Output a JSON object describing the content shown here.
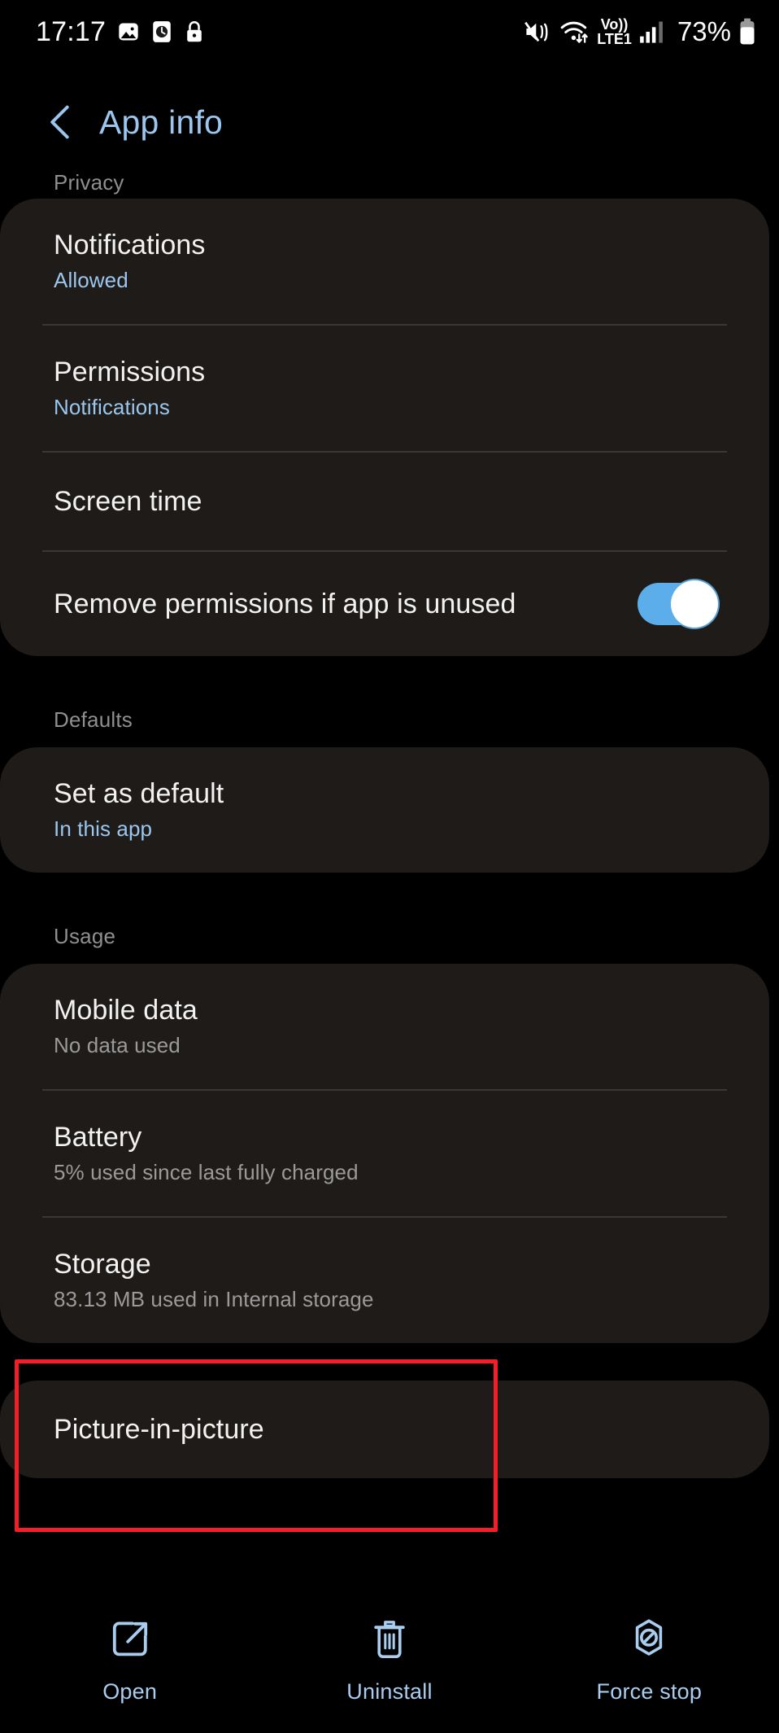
{
  "status_bar": {
    "time": "17:17",
    "left_icons": [
      "photo-icon",
      "alarm-clock-icon",
      "lock-icon"
    ],
    "right_icons": [
      "mute-vibrate-icon",
      "wifi-data-icon",
      "volte-icon",
      "signal-bars-icon",
      "battery-icon"
    ],
    "network_label_top": "Vo))",
    "network_label_bottom": "LTE1",
    "battery_percent": "73%"
  },
  "header": {
    "title": "App info",
    "back_icon": "chevron-left-icon"
  },
  "colors": {
    "accent_blue": "#9BC7EE",
    "toggle_on": "#5BAEEA",
    "highlight_red": "#F41E28",
    "card_bg": "#1E1B18",
    "page_bg": "#000000"
  },
  "sections": [
    {
      "header": "Privacy",
      "rows": [
        {
          "title": "Notifications",
          "sub": "Allowed",
          "sub_color": "blue",
          "control": "none"
        },
        {
          "title": "Permissions",
          "sub": "Notifications",
          "sub_color": "blue",
          "control": "none"
        },
        {
          "title": "Screen time",
          "sub": "",
          "sub_color": "none",
          "control": "none"
        },
        {
          "title": "Remove permissions if app is unused",
          "sub": "",
          "sub_color": "none",
          "control": "switch",
          "switch_on": true
        }
      ]
    },
    {
      "header": "Defaults",
      "rows": [
        {
          "title": "Set as default",
          "sub": "In this app",
          "sub_color": "blue",
          "control": "none"
        }
      ]
    },
    {
      "header": "Usage",
      "rows": [
        {
          "title": "Mobile data",
          "sub": "No data used",
          "sub_color": "gray",
          "control": "none"
        },
        {
          "title": "Battery",
          "sub": "5% used since last fully charged",
          "sub_color": "gray",
          "control": "none"
        },
        {
          "title": "Storage",
          "sub": "83.13 MB used in Internal storage",
          "sub_color": "gray",
          "control": "none",
          "highlighted": true
        }
      ]
    },
    {
      "header": "",
      "rows": [
        {
          "title": "Picture-in-picture",
          "sub": "",
          "sub_color": "none",
          "control": "none"
        }
      ]
    }
  ],
  "bottom_bar": {
    "items": [
      {
        "label": "Open",
        "icon": "open-in-new-icon"
      },
      {
        "label": "Uninstall",
        "icon": "trash-can-icon"
      },
      {
        "label": "Force stop",
        "icon": "block-stop-icon"
      }
    ]
  }
}
